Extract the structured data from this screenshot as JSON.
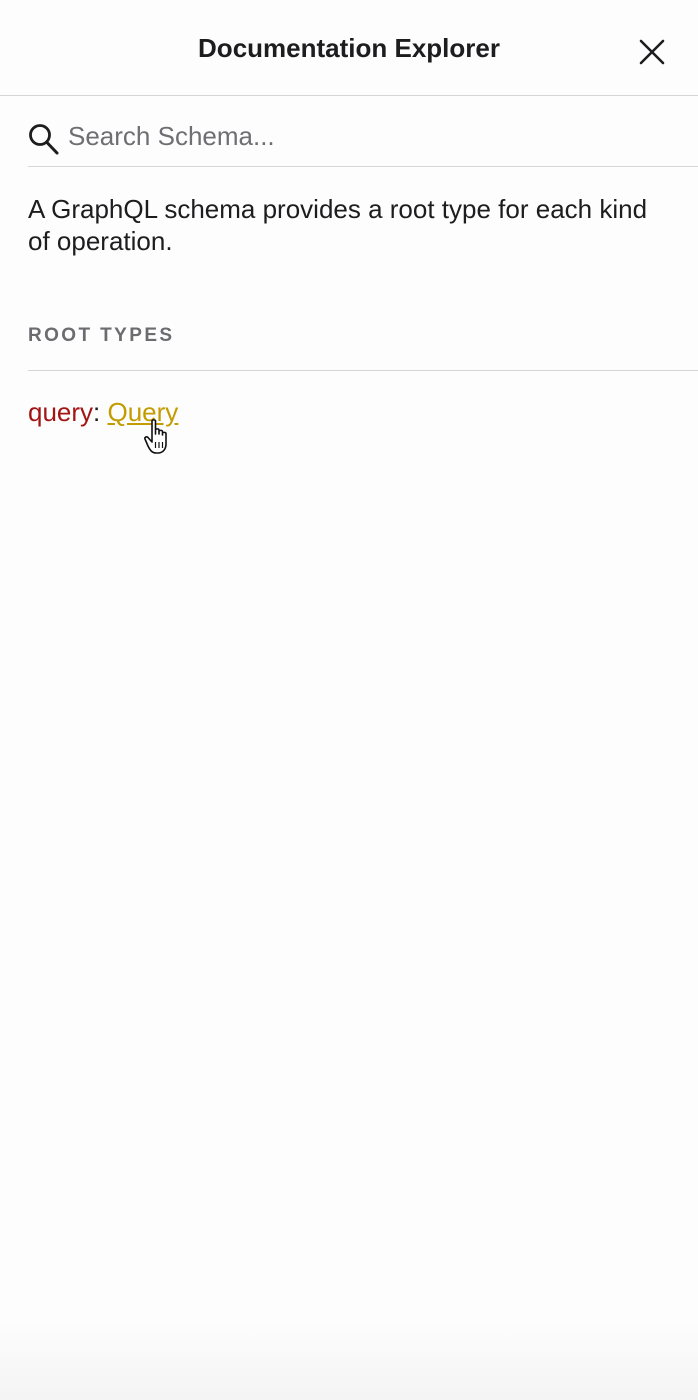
{
  "header": {
    "title": "Documentation Explorer",
    "close_icon": "close-icon"
  },
  "search": {
    "placeholder": "Search Schema...",
    "value": "",
    "icon": "search-icon"
  },
  "description": "A GraphQL schema provides a root type for each kind of operation.",
  "root_types": {
    "section_title": "ROOT TYPES",
    "items": [
      {
        "field": "query",
        "separator": ": ",
        "type": "Query"
      }
    ]
  },
  "colors": {
    "field_name": "#a31515",
    "type_link": "#c29c00",
    "section_title": "#6b6b70",
    "divider": "#d6d6d6"
  }
}
